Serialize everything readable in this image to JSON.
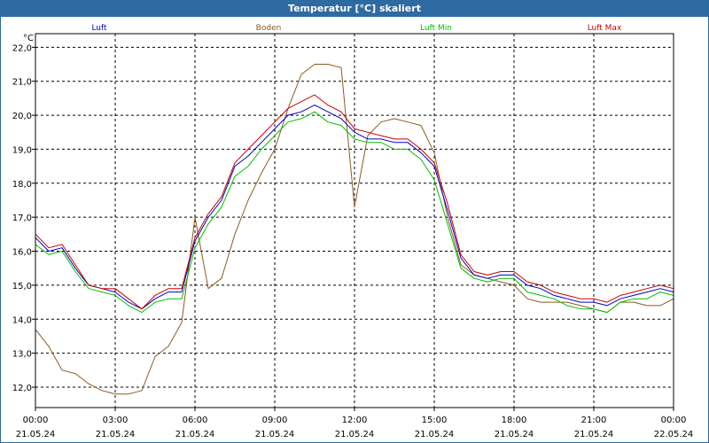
{
  "chart_data": {
    "type": "line",
    "title": "Temperatur [°C] skaliert",
    "ylabel": "°C",
    "ylim": [
      11.4,
      22.4
    ],
    "grid": true,
    "legend_position": "top",
    "yticks": [
      "12,0",
      "13,0",
      "14,0",
      "15,0",
      "16,0",
      "17,0",
      "18,0",
      "19,0",
      "20,0",
      "21,0",
      "22,0"
    ],
    "xticks": [
      {
        "time": "00:00",
        "date": "21.05.24"
      },
      {
        "time": "03:00",
        "date": "21.05.24"
      },
      {
        "time": "06:00",
        "date": "21.05.24"
      },
      {
        "time": "09:00",
        "date": "21.05.24"
      },
      {
        "time": "12:00",
        "date": "21.05.24"
      },
      {
        "time": "15:00",
        "date": "21.05.24"
      },
      {
        "time": "18:00",
        "date": "21.05.24"
      },
      {
        "time": "21:00",
        "date": "21.05.24"
      },
      {
        "time": "00:00",
        "date": "22.05.24"
      }
    ],
    "x_hours": [
      0,
      0.5,
      1,
      1.5,
      2,
      2.5,
      3,
      3.5,
      4,
      4.5,
      5,
      5.5,
      6,
      6.5,
      7,
      7.5,
      8,
      8.5,
      9,
      9.5,
      10,
      10.5,
      11,
      11.5,
      12,
      12.5,
      13,
      13.5,
      14,
      14.5,
      15,
      15.5,
      16,
      16.5,
      17,
      17.5,
      18,
      18.5,
      19,
      19.5,
      20,
      20.5,
      21,
      21.5,
      22,
      22.5,
      23,
      23.5,
      24
    ],
    "series": [
      {
        "name": "Luft",
        "color": "#0000c8",
        "values": [
          16.4,
          16.0,
          16.1,
          15.5,
          15.0,
          14.9,
          14.8,
          14.5,
          14.3,
          14.6,
          14.8,
          14.8,
          16.3,
          17.0,
          17.5,
          18.5,
          18.8,
          19.2,
          19.6,
          20.0,
          20.1,
          20.3,
          20.1,
          19.9,
          19.5,
          19.3,
          19.3,
          19.2,
          19.2,
          18.9,
          18.5,
          17.2,
          15.8,
          15.3,
          15.2,
          15.3,
          15.3,
          15.0,
          14.9,
          14.7,
          14.6,
          14.5,
          14.5,
          14.4,
          14.6,
          14.7,
          14.8,
          14.9,
          14.8
        ]
      },
      {
        "name": "Boden",
        "color": "#8c5a1e",
        "values": [
          13.7,
          13.2,
          12.5,
          12.4,
          12.1,
          11.9,
          11.8,
          11.8,
          11.9,
          12.9,
          13.2,
          13.9,
          17.0,
          14.9,
          15.2,
          16.5,
          17.5,
          18.3,
          19.0,
          20.2,
          21.2,
          21.5,
          21.5,
          21.4,
          17.3,
          19.4,
          19.8,
          19.9,
          19.8,
          19.7,
          18.9,
          17.0,
          15.6,
          15.3,
          15.2,
          15.1,
          15.0,
          14.6,
          14.5,
          14.5,
          14.5,
          14.4,
          14.3,
          14.2,
          14.5,
          14.5,
          14.4,
          14.4,
          14.6
        ]
      },
      {
        "name": "Luft Min",
        "color": "#00bf00",
        "values": [
          16.2,
          15.9,
          16.0,
          15.4,
          14.9,
          14.8,
          14.7,
          14.4,
          14.2,
          14.5,
          14.6,
          14.6,
          16.1,
          16.8,
          17.3,
          18.2,
          18.5,
          19.0,
          19.4,
          19.8,
          19.9,
          20.1,
          19.8,
          19.7,
          19.3,
          19.2,
          19.2,
          19.0,
          19.0,
          18.7,
          18.1,
          16.8,
          15.5,
          15.2,
          15.1,
          15.2,
          15.2,
          14.8,
          14.7,
          14.6,
          14.4,
          14.3,
          14.3,
          14.2,
          14.5,
          14.6,
          14.6,
          14.8,
          14.7
        ]
      },
      {
        "name": "Luft Max",
        "color": "#c80000",
        "values": [
          16.5,
          16.1,
          16.2,
          15.6,
          15.0,
          14.9,
          14.9,
          14.6,
          14.3,
          14.7,
          14.9,
          14.9,
          16.4,
          17.1,
          17.6,
          18.6,
          19.0,
          19.4,
          19.8,
          20.2,
          20.4,
          20.6,
          20.3,
          20.1,
          19.6,
          19.5,
          19.4,
          19.3,
          19.3,
          19.0,
          18.6,
          17.4,
          15.9,
          15.4,
          15.3,
          15.4,
          15.4,
          15.1,
          15.0,
          14.8,
          14.7,
          14.6,
          14.6,
          14.5,
          14.7,
          14.8,
          14.9,
          15.0,
          14.9
        ]
      }
    ]
  }
}
